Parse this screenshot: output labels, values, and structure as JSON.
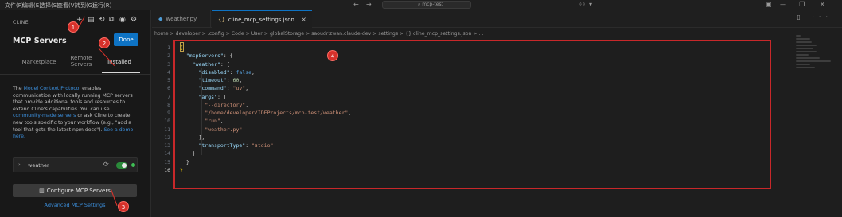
{
  "menu": [
    "文件(F)",
    "编辑(E)",
    "选择(S)",
    "查看(V)",
    "转到(G)",
    "运行(R)",
    "…"
  ],
  "search_placeholder": "mcp-test",
  "sidebar": {
    "panel_name": "CLINE",
    "title": "MCP Servers",
    "done_label": "Done",
    "tabs": {
      "marketplace": "Marketplace",
      "remote": "Remote Servers",
      "installed": "Installed"
    },
    "description": {
      "pre": "The ",
      "link1": "Model Context Protocol",
      "mid1": " enables communication with locally running MCP servers that provide additional tools and resources to extend Cline's capabilities. You can use ",
      "link2": "community-made servers",
      "mid2": " or ask Cline to create new tools specific to your workflow (e.g., \"add a tool that gets the latest npm docs\"). ",
      "link3": "See a demo here."
    },
    "server": {
      "name": "weather",
      "enabled": true
    },
    "configure_label": "Configure MCP Servers",
    "advanced_label": "Advanced MCP Settings"
  },
  "badges": [
    "1",
    "2",
    "3",
    "4"
  ],
  "editor": {
    "tabs": [
      {
        "label": "weather.py",
        "icon": "python-icon"
      },
      {
        "label": "cline_mcp_settings.json",
        "icon": "json-icon",
        "active": true
      }
    ],
    "breadcrumb": "home > developer > .config > Code > User > globalStorage > saoudrizwan.claude-dev > settings > {} cline_mcp_settings.json > ...",
    "line_numbers": [
      "1",
      "2",
      "3",
      "4",
      "5",
      "6",
      "7",
      "8",
      "9",
      "10",
      "11",
      "12",
      "13",
      "14",
      "15",
      "16"
    ],
    "active_line": 16
  },
  "code": {
    "l1": "{",
    "l2_key": "\"mcpServers\"",
    "l3_key": "\"weather\"",
    "l4_key": "\"disabled\"",
    "l4_val": "false",
    "l5_key": "\"timeout\"",
    "l5_val": "60",
    "l6_key": "\"command\"",
    "l6_val": "\"uv\"",
    "l7_key": "\"args\"",
    "l8_val": "\"--directory\"",
    "l9_val": "\"/home/developer/IDEProjects/mcp-test/weather\"",
    "l10_val": "\"run\"",
    "l11_val": "\"weather.py\"",
    "l13_key": "\"transportType\"",
    "l13_val": "\"stdio\"",
    "l16": "}"
  },
  "colors": {
    "accent": "#0e73c4",
    "badge": "#d6312b",
    "highlight": "#c8282a",
    "link": "#3b8edb"
  }
}
